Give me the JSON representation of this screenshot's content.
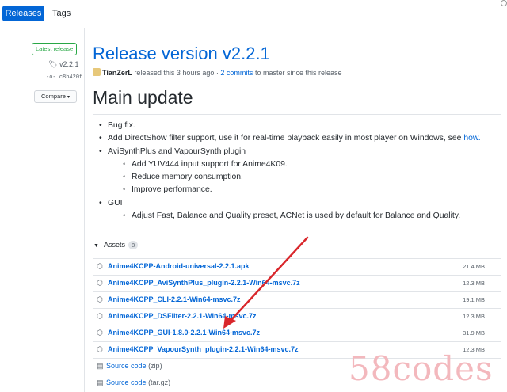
{
  "tabs": {
    "releases": "Releases",
    "tags": "Tags"
  },
  "sidebar": {
    "latest_badge": "Latest release",
    "tag": "v2.2.1",
    "commit": "c8b420f",
    "compare_label": "Compare"
  },
  "release": {
    "title": "Release version v2.2.1",
    "author": "TianZerL",
    "meta_mid": " released this 3 hours ago · ",
    "commits_link": "2 commits",
    "meta_end": " to master since this release"
  },
  "body": {
    "heading": "Main update",
    "items": [
      "Bug fix.",
      "Add DirectShow filter support, use it for real-time playback easily in most player on Windows, see",
      "how.",
      "AviSynthPlus and VapourSynth plugin",
      "Add YUV444 input support for Anime4K09.",
      "Reduce memory consumption.",
      "Improve performance.",
      "GUI",
      "Adjust Fast, Balance and Quality preset, ACNet is used by default for Balance and Quality."
    ]
  },
  "assets": {
    "label": "Assets",
    "count": "8",
    "files": [
      {
        "name": "Anime4KCPP-Android-universal-2.2.1.apk",
        "size": "21.4 MB"
      },
      {
        "name": "Anime4KCPP_AviSynthPlus_plugin-2.2.1-Win64-msvc.7z",
        "size": "12.3 MB"
      },
      {
        "name": "Anime4KCPP_CLI-2.2.1-Win64-msvc.7z",
        "size": "19.1 MB"
      },
      {
        "name": "Anime4KCPP_DSFilter-2.2.1-Win64-msvc.7z",
        "size": "12.3 MB"
      },
      {
        "name": "Anime4KCPP_GUI-1.8.0-2.2.1-Win64-msvc.7z",
        "size": "31.9 MB"
      },
      {
        "name": "Anime4KCPP_VapourSynth_plugin-2.2.1-Win64-msvc.7z",
        "size": "12.3 MB"
      }
    ],
    "source": [
      {
        "label": "Source code",
        "format": "(zip)"
      },
      {
        "label": "Source code",
        "format": "(tar.gz)"
      }
    ]
  },
  "annotation_color": "#d9262b",
  "watermark": "58codes"
}
